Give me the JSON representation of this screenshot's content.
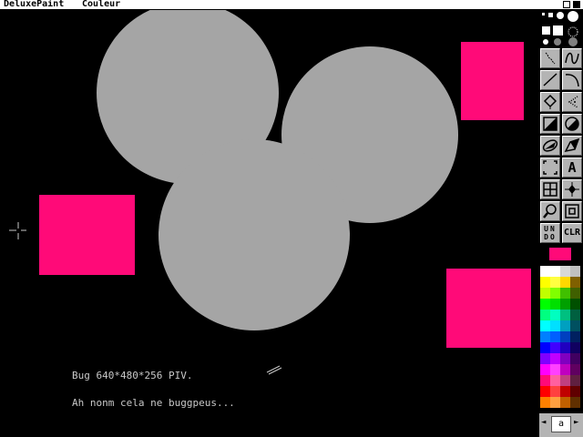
{
  "menubar": {
    "app_name": "DeluxePaint",
    "menu_couleur": "Couleur"
  },
  "canvas": {
    "line1": "Bug 640*480*256 PIV.",
    "line2": "Ah nonm cela ne buggpeus..."
  },
  "toolbox": {
    "undo_label": "UNDO",
    "clr_label": "CLR",
    "text_tool_label": "A"
  },
  "colors": {
    "foreground": "#ff0a78",
    "background": "#000000",
    "shape_gray": "#a5a5a5",
    "pink": "#ff0a78"
  },
  "palette": [
    "#ffffff",
    "#ffffff",
    "#d8d8d8",
    "#c0c0c0",
    "#ffff00",
    "#ffff40",
    "#ffd800",
    "#806000",
    "#c0ff00",
    "#80ff00",
    "#40c000",
    "#406000",
    "#00ff00",
    "#00e000",
    "#00a000",
    "#005000",
    "#00ff80",
    "#00ffc0",
    "#00c080",
    "#006040",
    "#00ffff",
    "#00e0ff",
    "#00a0c0",
    "#005060",
    "#0080ff",
    "#0060ff",
    "#0040c0",
    "#002060",
    "#0000ff",
    "#4000ff",
    "#2000c0",
    "#100060",
    "#8000ff",
    "#c000ff",
    "#8000c0",
    "#400060",
    "#ff00ff",
    "#ff40ff",
    "#c000c0",
    "#600060",
    "#ff0a78",
    "#ff60a0",
    "#c04080",
    "#602040",
    "#ff0000",
    "#ff4040",
    "#c00000",
    "#600000",
    "#ff8000",
    "#ffa040",
    "#c06000",
    "#603000"
  ],
  "bottom_bar": {
    "gadget_left": "◄",
    "gadget_mid": "a",
    "gadget_right": "►"
  }
}
